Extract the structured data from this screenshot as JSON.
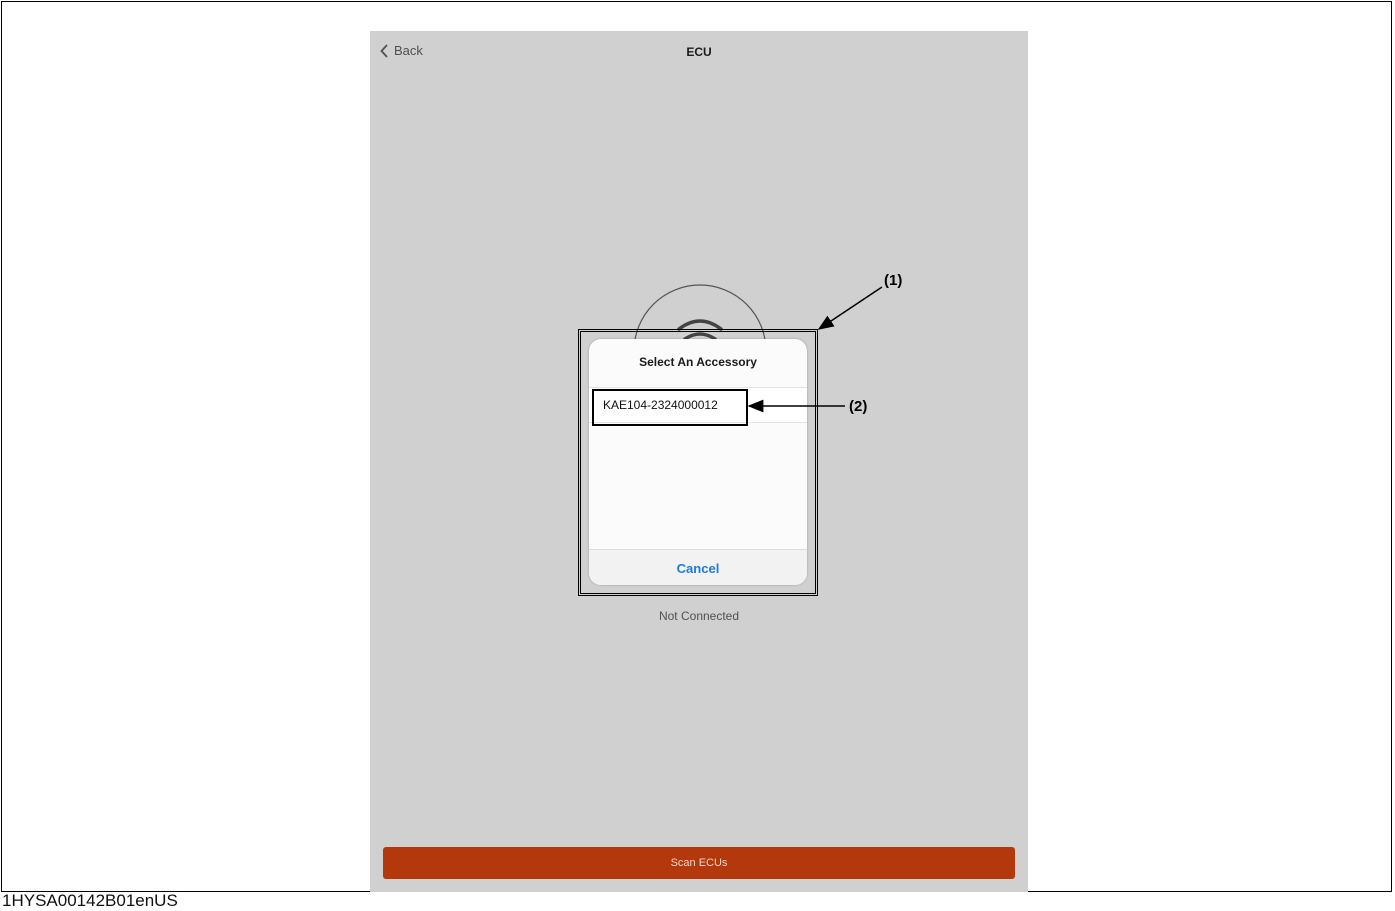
{
  "nav": {
    "back_label": "Back",
    "title": "ECU"
  },
  "dialog": {
    "title": "Select An Accessory",
    "items": [
      "KAE104-2324000012"
    ],
    "cancel_label": "Cancel"
  },
  "status": "Not Connected",
  "scan_button_label": "Scan ECUs",
  "callouts": {
    "one": "(1)",
    "two": "(2)"
  },
  "document_id": "1HYSA00142B01enUS",
  "colors": {
    "screen_bg": "#d0d0d0",
    "scan_button": "#b3380b",
    "link_blue": "#1e7be0"
  },
  "icons": {
    "back": "chevron-left-icon",
    "signal": "wireless-signal-icon"
  }
}
